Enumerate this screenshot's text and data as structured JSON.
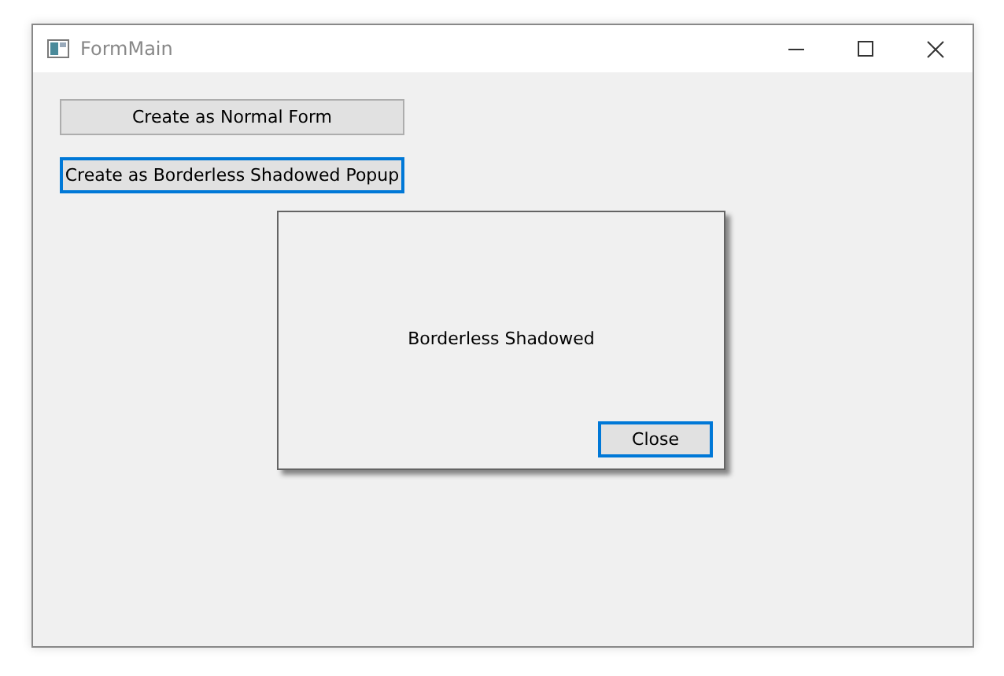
{
  "window": {
    "title": "FormMain"
  },
  "buttons": [
    {
      "label": "Create as Normal Form",
      "focused": false
    },
    {
      "label": "Create as Borderless Shadowed Popup",
      "focused": true
    }
  ],
  "popup": {
    "message": "Borderless Shadowed",
    "close_button": {
      "label": "Close",
      "focused": true
    }
  }
}
